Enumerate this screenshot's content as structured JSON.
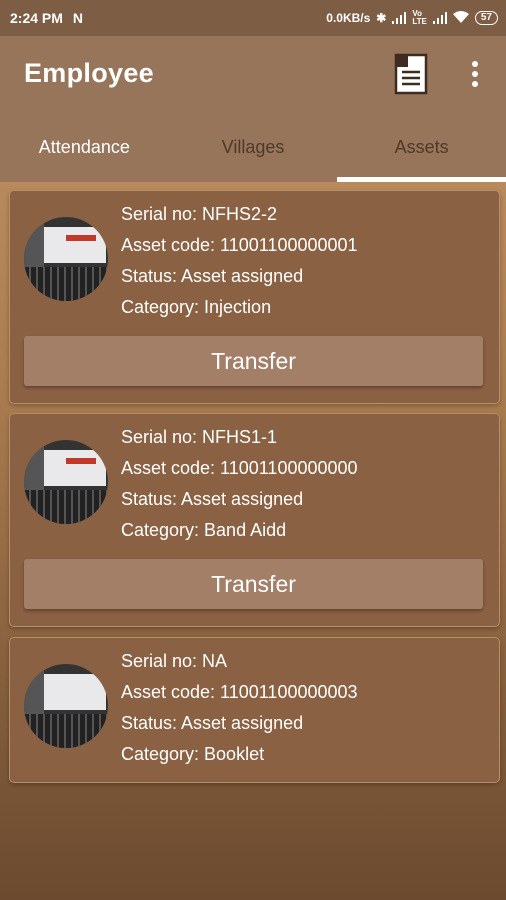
{
  "status_bar": {
    "time": "2:24 PM",
    "notification_icon": "N",
    "network_speed": "0.0KB/s",
    "battery": "57",
    "icons": [
      "bluetooth-icon",
      "signal-icon",
      "volte-icon",
      "signal-icon",
      "wifi-icon",
      "battery-icon"
    ]
  },
  "appbar": {
    "title": "Employee",
    "icons": [
      "document-icon",
      "more-vert-icon"
    ]
  },
  "tabs": [
    {
      "label": "Attendance"
    },
    {
      "label": "Villages"
    },
    {
      "label": "Assets",
      "selected": true
    }
  ],
  "assets": [
    {
      "serial": "Serial no: NFHS2-2",
      "code": "Asset code: 11001100000001",
      "status": "Status: Asset assigned",
      "category": "Category: Injection",
      "button": "Transfer"
    },
    {
      "serial": "Serial no: NFHS1-1",
      "code": "Asset code: 11001100000000",
      "status": "Status: Asset assigned",
      "category": "Category: Band Aidd",
      "button": "Transfer"
    },
    {
      "serial": "Serial no: NA",
      "code": "Asset code: 11001100000003",
      "status": "Status: Asset assigned",
      "category": "Category: Booklet"
    }
  ],
  "colors": {
    "appbar": "#97755a",
    "statusbar": "#7d5d44",
    "card": "#8a6143",
    "button": "#a47f68",
    "tab_indicator": "#ffffff"
  }
}
